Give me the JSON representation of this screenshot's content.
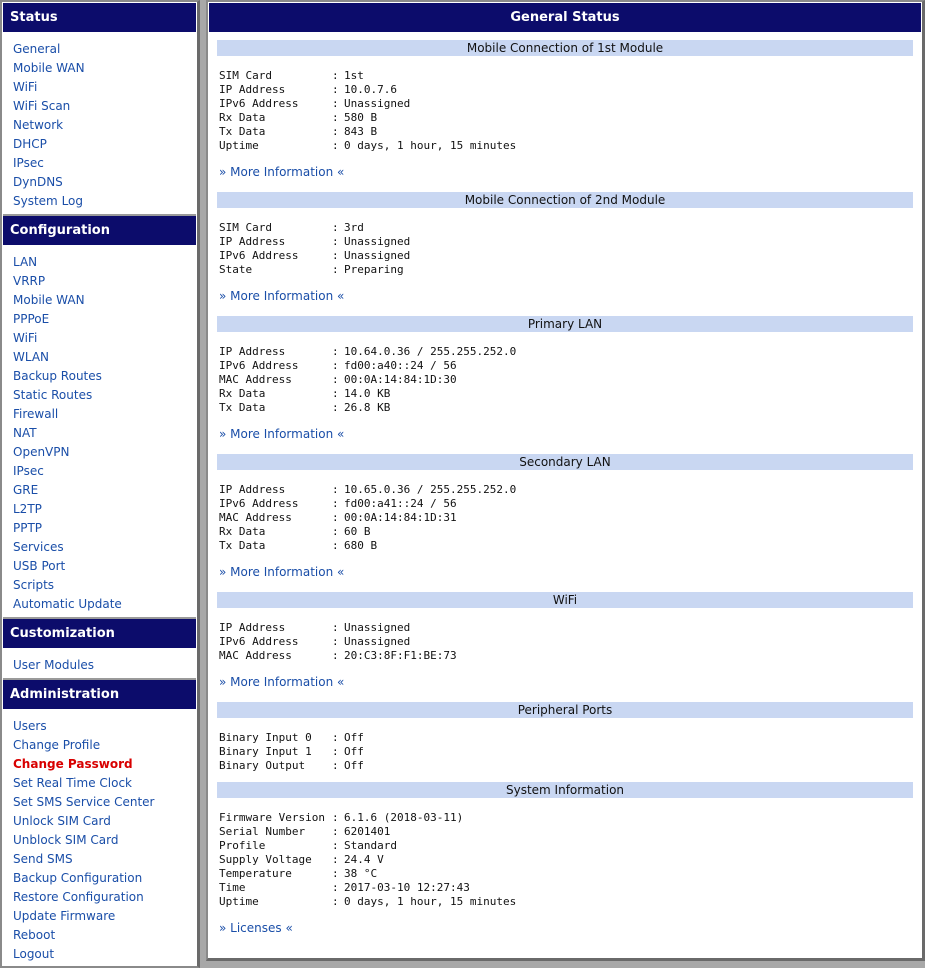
{
  "sidebar": {
    "status": {
      "title": "Status",
      "items": [
        "General",
        "Mobile WAN",
        "WiFi",
        "WiFi Scan",
        "Network",
        "DHCP",
        "IPsec",
        "DynDNS",
        "System Log"
      ]
    },
    "configuration": {
      "title": "Configuration",
      "items": [
        "LAN",
        "VRRP",
        "Mobile WAN",
        "PPPoE",
        "WiFi",
        "WLAN",
        "Backup Routes",
        "Static Routes",
        "Firewall",
        "NAT",
        "OpenVPN",
        "IPsec",
        "GRE",
        "L2TP",
        "PPTP",
        "Services",
        "USB Port",
        "Scripts",
        "Automatic Update"
      ]
    },
    "customization": {
      "title": "Customization",
      "items": [
        "User Modules"
      ]
    },
    "administration": {
      "title": "Administration",
      "active_index": 2,
      "items": [
        "Users",
        "Change Profile",
        "Change Password",
        "Set Real Time Clock",
        "Set SMS Service Center",
        "Unlock SIM Card",
        "Unblock SIM Card",
        "Send SMS",
        "Backup Configuration",
        "Restore Configuration",
        "Update Firmware",
        "Reboot",
        "Logout"
      ]
    }
  },
  "main": {
    "title": "General Status",
    "panels": [
      {
        "title": "Mobile Connection of 1st Module",
        "rows": [
          {
            "key": "SIM Card",
            "value": "1st"
          },
          {
            "key": "IP Address",
            "value": "10.0.7.6"
          },
          {
            "key": "IPv6 Address",
            "value": "Unassigned"
          },
          {
            "key": "Rx Data",
            "value": "580 B"
          },
          {
            "key": "Tx Data",
            "value": "843 B"
          },
          {
            "key": "Uptime",
            "value": "0 days, 1 hour, 15 minutes"
          }
        ],
        "link": "» More Information «"
      },
      {
        "title": "Mobile Connection of 2nd Module",
        "rows": [
          {
            "key": "SIM Card",
            "value": "3rd"
          },
          {
            "key": "IP Address",
            "value": "Unassigned"
          },
          {
            "key": "IPv6 Address",
            "value": "Unassigned"
          },
          {
            "key": "State",
            "value": "Preparing"
          }
        ],
        "link": "» More Information «"
      },
      {
        "title": "Primary LAN",
        "rows": [
          {
            "key": "IP Address",
            "value": "10.64.0.36 / 255.255.252.0"
          },
          {
            "key": "IPv6 Address",
            "value": "fd00:a40::24 / 56"
          },
          {
            "key": "MAC Address",
            "value": "00:0A:14:84:1D:30"
          },
          {
            "key": "Rx Data",
            "value": "14.0 KB"
          },
          {
            "key": "Tx Data",
            "value": "26.8 KB"
          }
        ],
        "link": "» More Information «"
      },
      {
        "title": "Secondary LAN",
        "rows": [
          {
            "key": "IP Address",
            "value": "10.65.0.36 / 255.255.252.0"
          },
          {
            "key": "IPv6 Address",
            "value": "fd00:a41::24 / 56"
          },
          {
            "key": "MAC Address",
            "value": "00:0A:14:84:1D:31"
          },
          {
            "key": "Rx Data",
            "value": "60 B"
          },
          {
            "key": "Tx Data",
            "value": "680 B"
          }
        ],
        "link": "» More Information «"
      },
      {
        "title": "WiFi",
        "rows": [
          {
            "key": "IP Address",
            "value": "Unassigned"
          },
          {
            "key": "IPv6 Address",
            "value": "Unassigned"
          },
          {
            "key": "MAC Address",
            "value": "20:C3:8F:F1:BE:73"
          }
        ],
        "link": "» More Information «"
      },
      {
        "title": "Peripheral Ports",
        "rows": [
          {
            "key": "Binary Input 0",
            "value": "Off"
          },
          {
            "key": "Binary Input 1",
            "value": "Off"
          },
          {
            "key": "Binary Output",
            "value": "Off"
          }
        ],
        "link": ""
      },
      {
        "title": "System Information",
        "rows": [
          {
            "key": "Firmware Version",
            "value": "6.1.6 (2018-03-11)"
          },
          {
            "key": "Serial Number",
            "value": "6201401"
          },
          {
            "key": "Profile",
            "value": "Standard"
          },
          {
            "key": "Supply Voltage",
            "value": "24.4 V"
          },
          {
            "key": "Temperature",
            "value": "38 °C"
          },
          {
            "key": "Time",
            "value": "2017-03-10 12:27:43"
          },
          {
            "key": "Uptime",
            "value": "0 days, 1 hour, 15 minutes"
          }
        ],
        "link": "» Licenses «"
      }
    ]
  }
}
